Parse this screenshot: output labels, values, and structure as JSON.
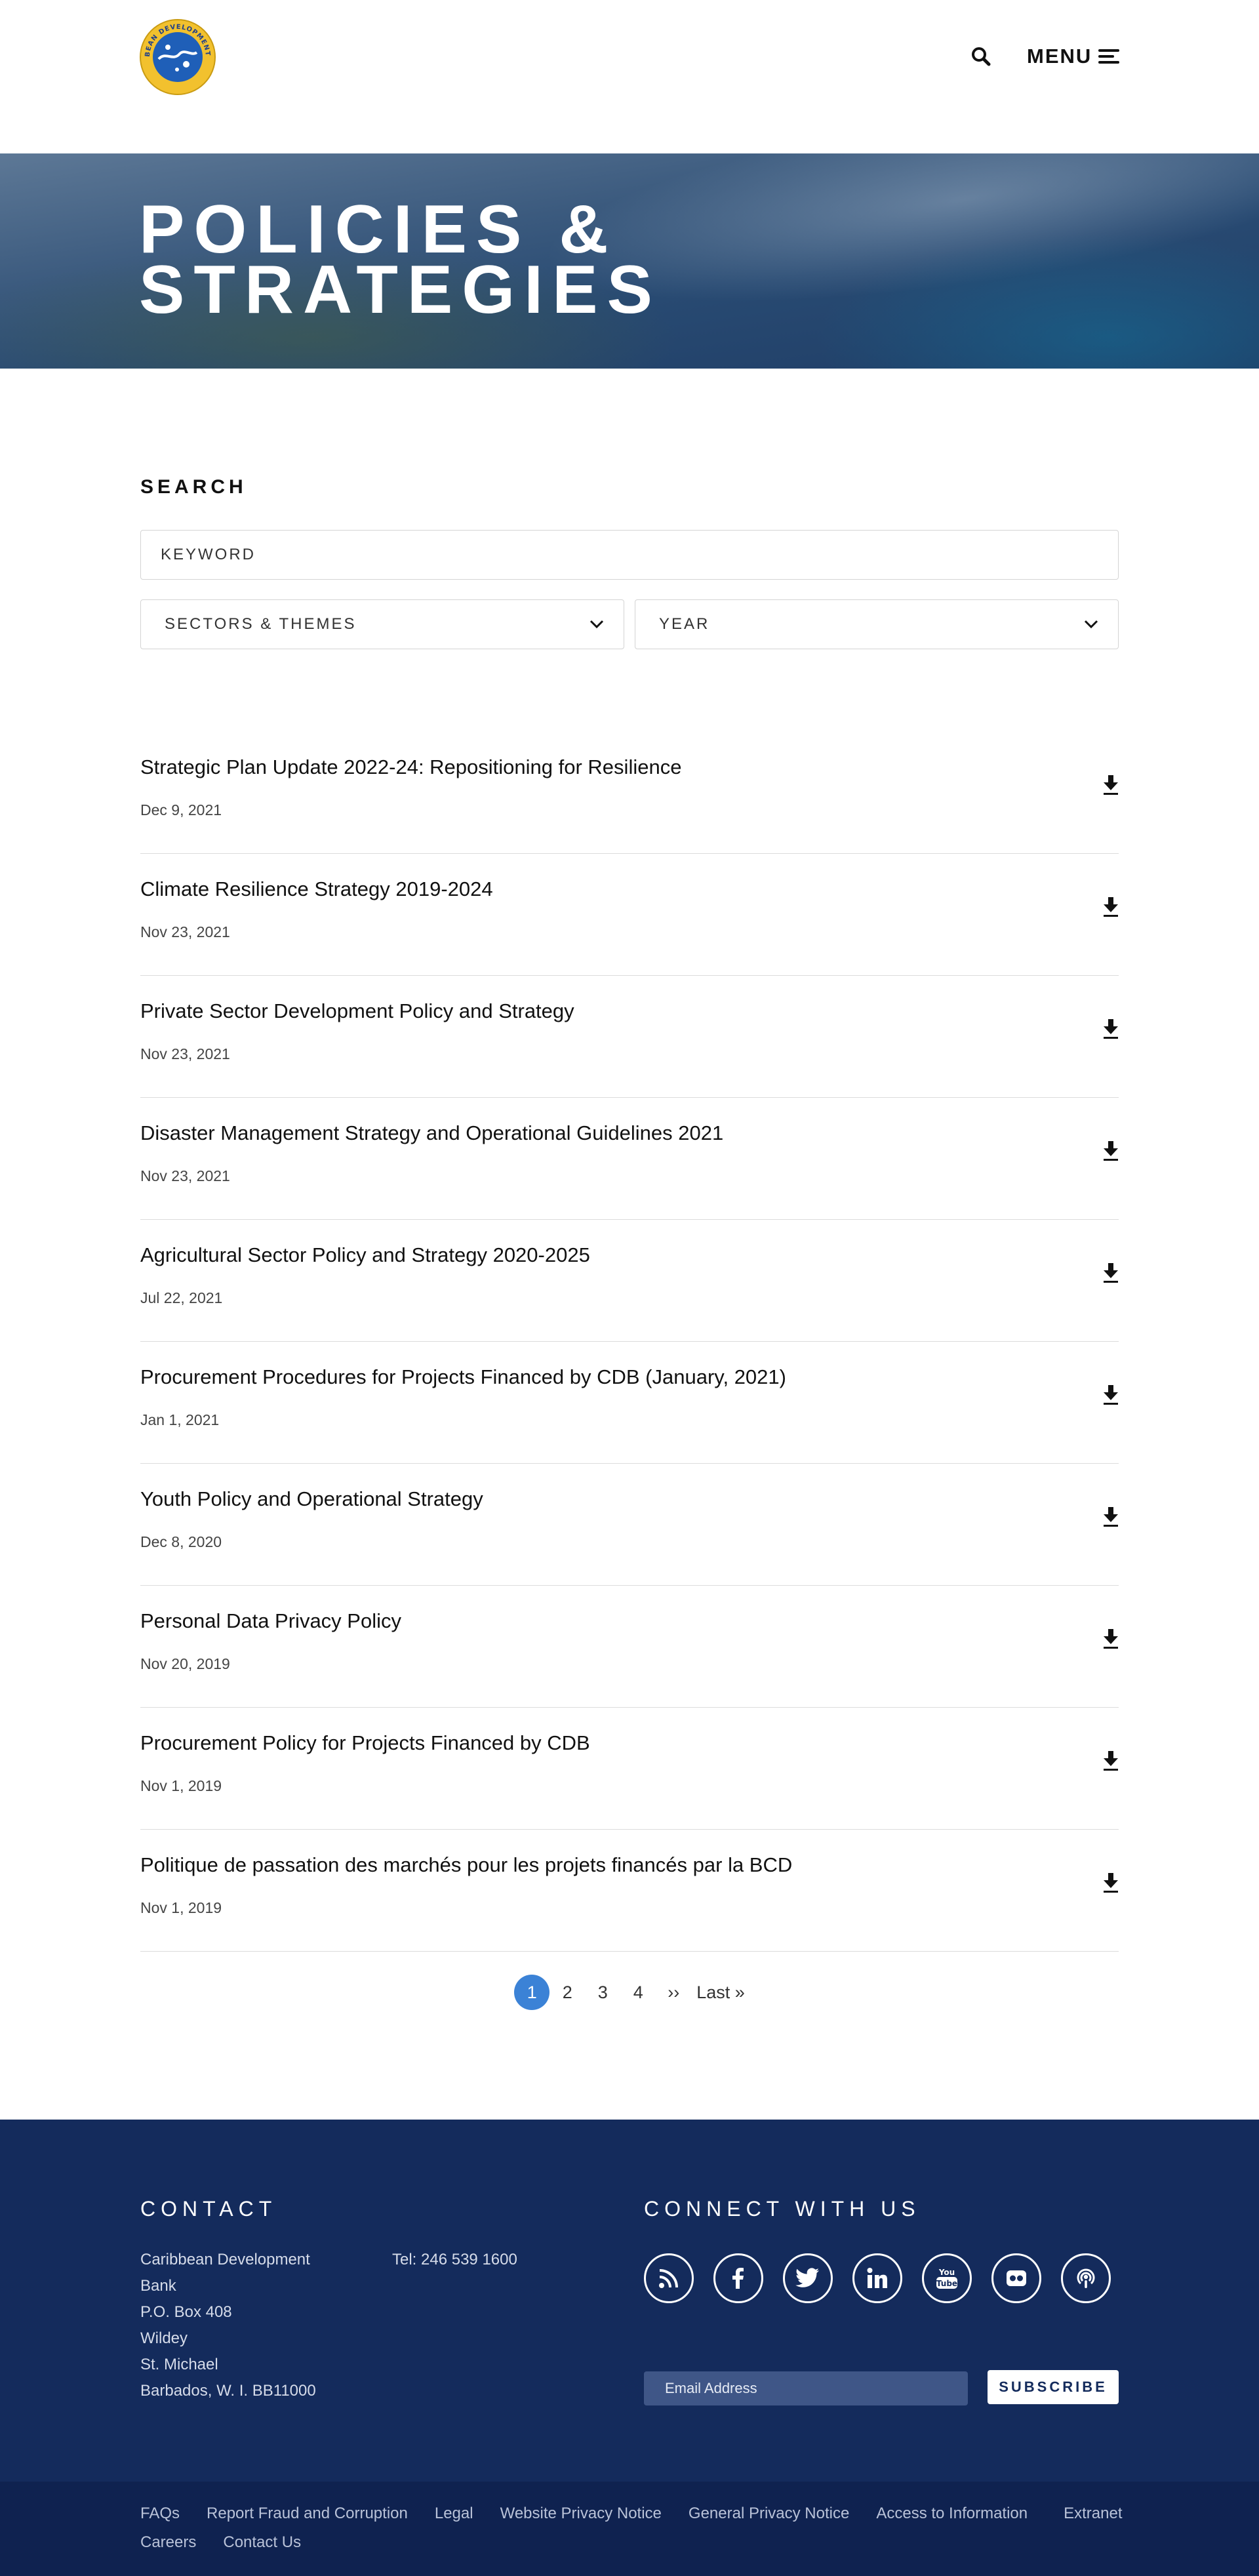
{
  "header": {
    "menu_label": "MENU",
    "logo_ring_text": "CARIBBEAN DEVELOPMENT BANK",
    "colors": {
      "logo_ring": "#f2c12e",
      "logo_center": "#1f5fb8"
    }
  },
  "hero": {
    "title_line1": "POLICIES &",
    "title_line2": "STRATEGIES"
  },
  "search": {
    "heading": "SEARCH",
    "keyword_placeholder": "KEYWORD",
    "sectors_label": "SECTORS & THEMES",
    "year_label": "YEAR"
  },
  "documents": [
    {
      "title": "Strategic Plan Update 2022-24: Repositioning for Resilience",
      "date": "Dec 9, 2021"
    },
    {
      "title": "Climate Resilience Strategy 2019-2024",
      "date": "Nov 23, 2021"
    },
    {
      "title": "Private Sector Development Policy and Strategy",
      "date": "Nov 23, 2021"
    },
    {
      "title": "Disaster Management Strategy and Operational Guidelines 2021",
      "date": "Nov 23, 2021"
    },
    {
      "title": "Agricultural Sector Policy and Strategy 2020-2025",
      "date": "Jul 22, 2021"
    },
    {
      "title": "Procurement Procedures for Projects Financed by CDB (January, 2021)",
      "date": "Jan 1, 2021"
    },
    {
      "title": "Youth Policy and Operational Strategy",
      "date": "Dec 8, 2020"
    },
    {
      "title": "Personal Data Privacy Policy",
      "date": "Nov 20, 2019"
    },
    {
      "title": "Procurement Policy for Projects Financed by CDB",
      "date": "Nov 1, 2019"
    },
    {
      "title": "Politique de passation des marchés pour les projets financés par la BCD",
      "date": "Nov 1, 2019"
    }
  ],
  "pagination": {
    "pages": [
      "1",
      "2",
      "3",
      "4"
    ],
    "current": "1",
    "next": "››",
    "last": "Last »"
  },
  "footer": {
    "contact_heading": "CONTACT",
    "address_lines": [
      "Caribbean Development",
      "Bank",
      "P.O. Box 408",
      "Wildey",
      "St. Michael",
      "Barbados, W. I. BB11000"
    ],
    "tel": "Tel: 246 539 1600",
    "connect_heading": "CONNECT WITH US",
    "socials": [
      "rss-icon",
      "facebook-icon",
      "twitter-icon",
      "linkedin-icon",
      "youtube-icon",
      "flickr-icon",
      "podcast-icon"
    ],
    "email_placeholder": "Email Address",
    "subscribe_label": "SUBSCRIBE",
    "colors": {
      "footer_bg": "#142b5c",
      "subfooter_bg": "#0f2250",
      "accent": "#3b82d6"
    }
  },
  "subfooter": {
    "links": [
      "FAQs",
      "Report Fraud and Corruption",
      "Legal",
      "Website Privacy Notice",
      "General Privacy Notice",
      "Access to Information",
      "Extranet",
      "Careers",
      "Contact Us"
    ]
  }
}
